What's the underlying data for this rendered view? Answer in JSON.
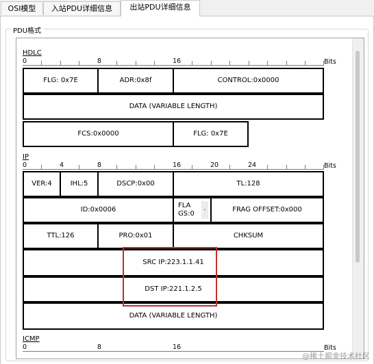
{
  "tabs": [
    {
      "label": "OSI模型"
    },
    {
      "label": "入站PDU详细信息"
    },
    {
      "label": "出站PDU详细信息"
    }
  ],
  "group_title": "PDU格式",
  "bits_label": "Bits",
  "hdlc": {
    "label": "HDLC",
    "ruler": [
      "0",
      "8",
      "16"
    ],
    "fields": {
      "flg1": "FLG: 0x7E",
      "adr": "ADR:0x8f",
      "control": "CONTROL:0x0000",
      "data": "DATA (VARIABLE LENGTH)",
      "fcs": "FCS:0x0000",
      "flg2": "FLG: 0x7E"
    }
  },
  "ip": {
    "label": "IP",
    "ruler": [
      "0",
      "4",
      "8",
      "16",
      "20",
      "24"
    ],
    "fields": {
      "ver": "VER:4",
      "ihl": "IHL:5",
      "dscp": "DSCP:0x00",
      "tl": "TL:128",
      "id": "ID:0x0006",
      "flags_l1": "FLA",
      "flags_l2": "GS:0",
      "flags_dot": ".",
      "frag": "FRAG OFFSET:0x000",
      "ttl": "TTL:126",
      "pro": "PRO:0x01",
      "chksum": "CHKSUM",
      "src": "SRC IP:223.1.1.41",
      "dst": "DST IP:221.1.2.5",
      "data": "DATA (VARIABLE LENGTH)"
    }
  },
  "icmp": {
    "label": "ICMP",
    "ruler": [
      "0",
      "8",
      "16"
    ]
  },
  "watermark": "@稀土掘金技术社区",
  "colors": {
    "highlight": "#c0302a",
    "panel_bg": "#ffffff",
    "window_bg": "#f0f0f0"
  }
}
